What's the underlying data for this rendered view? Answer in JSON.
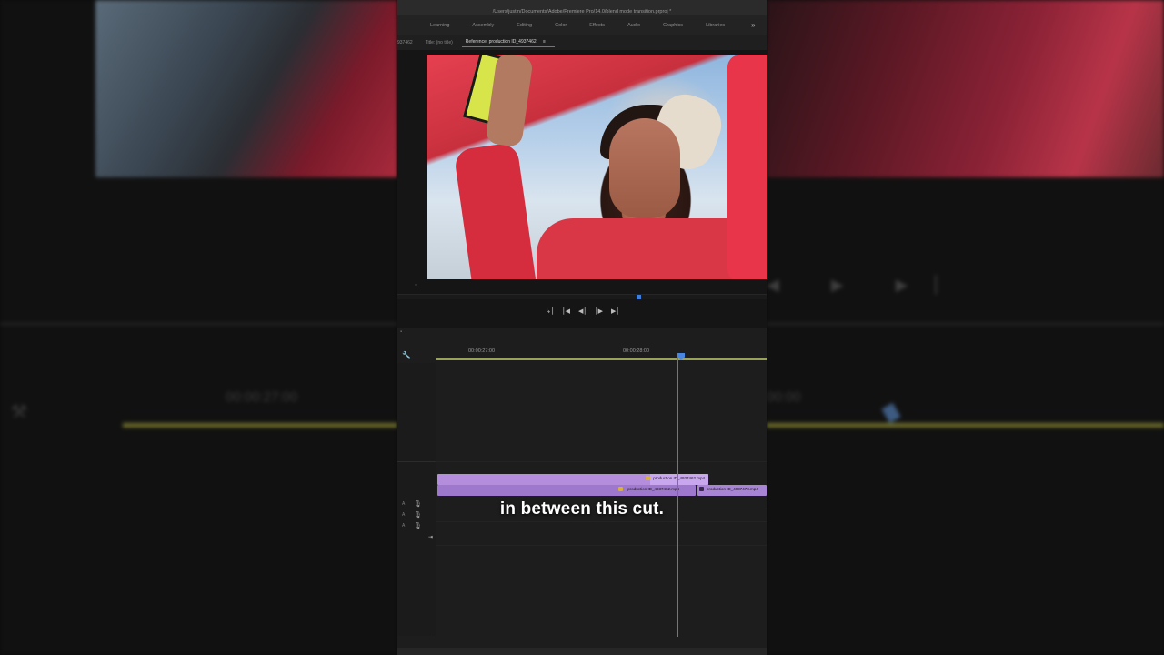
{
  "window": {
    "title": "/Users/justin/Documents/Adobe/Premiere Pro/14.0/blend mode transition.prproj *"
  },
  "workspaces": [
    "Learning",
    "Assembly",
    "Editing",
    "Color",
    "Effects",
    "Audio",
    "Graphics",
    "Libraries"
  ],
  "workspace_more": "»",
  "monitor_tabs": {
    "source_fragment": "937462",
    "title_tab": "Title: (no title)",
    "reference_tab": "Reference: production ID_4937462",
    "reference_menu": "≡"
  },
  "transport": [
    "↳⎮",
    "⎮◀",
    "◀⎮",
    "⎮▶",
    "▶⎮"
  ],
  "timeline": {
    "timecodes": [
      "00:00:27:00",
      "00:00:28:00"
    ],
    "tracks": [
      {
        "label": "A",
        "mic": "🎙"
      },
      {
        "label": "A",
        "mic": "🎙"
      },
      {
        "label": "A",
        "mic": "🎙"
      }
    ],
    "clips": {
      "v2": "production ID_4937462.mp4",
      "v1a": "production ID_4937462.mp4",
      "v1b": "production ID_4937473.mp4"
    },
    "tool_icon": "🔧",
    "end_icon": "⇥"
  },
  "backdrop": {
    "left_timecode": "00:00:27:00",
    "right_timecode": "00:00"
  },
  "caption": "in between this cut."
}
